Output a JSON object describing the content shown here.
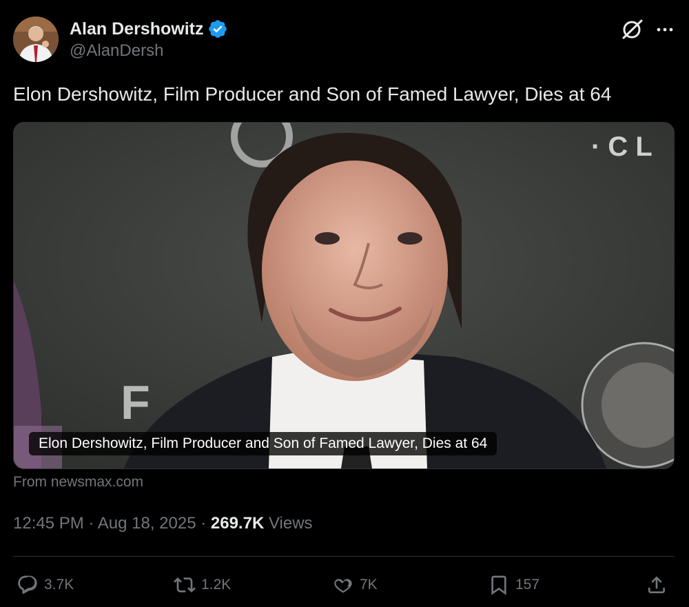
{
  "author": {
    "display_name": "Alan Dershowitz",
    "handle": "@AlanDersh",
    "verified_color": "#1d9bf0"
  },
  "header_icons": [
    "grok-icon",
    "more-icon"
  ],
  "tweet": {
    "text": "Elon Dershowitz, Film Producer and Son of Famed Lawyer, Dies at 64"
  },
  "link_card": {
    "caption": "Elon Dershowitz, Film Producer and Son of Famed Lawyer, Dies at 64",
    "source": "From newsmax.com"
  },
  "meta": {
    "time": "12:45 PM",
    "separator": "·",
    "date": "Aug 18, 2025",
    "views_count": "269.7K",
    "views_label": "Views"
  },
  "actions": {
    "replies": "3.7K",
    "reposts": "1.2K",
    "likes": "7K",
    "bookmarks": "157"
  },
  "colors": {
    "background": "#000000",
    "text_primary": "#e7e9ea",
    "text_secondary": "#71767b",
    "divider": "#2f3336"
  }
}
